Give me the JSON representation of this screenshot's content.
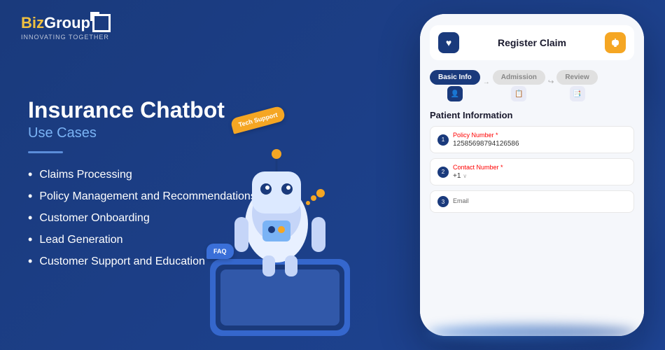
{
  "logo": {
    "brand": "BizGroup",
    "highlight": "Biz",
    "tagline": "INNOVATING TOGETHER"
  },
  "left": {
    "main_title": "Insurance Chatbot",
    "sub_title": "Use Cases",
    "use_cases": [
      "Claims Processing",
      "Policy Management and Recommendations",
      "Customer Onboarding",
      "Lead Generation",
      "Customer Support and Education"
    ]
  },
  "phone": {
    "header": {
      "title": "Register Claim",
      "heart_icon": "♥",
      "bell_icon": "🔔"
    },
    "steps": [
      {
        "label": "Basic Info",
        "active": true
      },
      {
        "label": "Admission",
        "active": false
      },
      {
        "label": "Review",
        "active": false
      }
    ],
    "patient_section": "Patient Information",
    "fields": [
      {
        "label": "Policy Number",
        "required": true,
        "value": "12585698794126586",
        "num": null
      },
      {
        "label": "Contact Number",
        "required": true,
        "value": "+1",
        "num": null
      },
      {
        "label": "Email",
        "required": false,
        "value": "",
        "num": "3"
      }
    ]
  },
  "decorations": {
    "tech_support_bubble": "Tech Support",
    "faq_bubble": "FAQ"
  },
  "colors": {
    "bg_dark": "#1a3a7c",
    "accent_blue": "#3a6fd8",
    "accent_orange": "#f5a623",
    "text_white": "#ffffff",
    "text_light": "#7ab3f5"
  }
}
